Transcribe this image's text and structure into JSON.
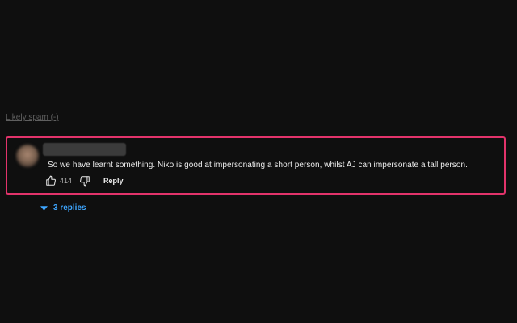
{
  "spam_link": "Likely spam (-)",
  "comment": {
    "text": "So we have learnt something. Niko is good at impersonating a short person, whilst AJ can impersonate a tall person.",
    "likes": "414",
    "reply_label": "Reply"
  },
  "replies": {
    "label": "3 replies"
  },
  "colors": {
    "background": "#0f0f0f",
    "highlight_border": "#e2336b",
    "link_blue": "#3ea6ff"
  },
  "icons": [
    "thumb-up-icon",
    "thumb-down-icon",
    "caret-down-icon"
  ]
}
